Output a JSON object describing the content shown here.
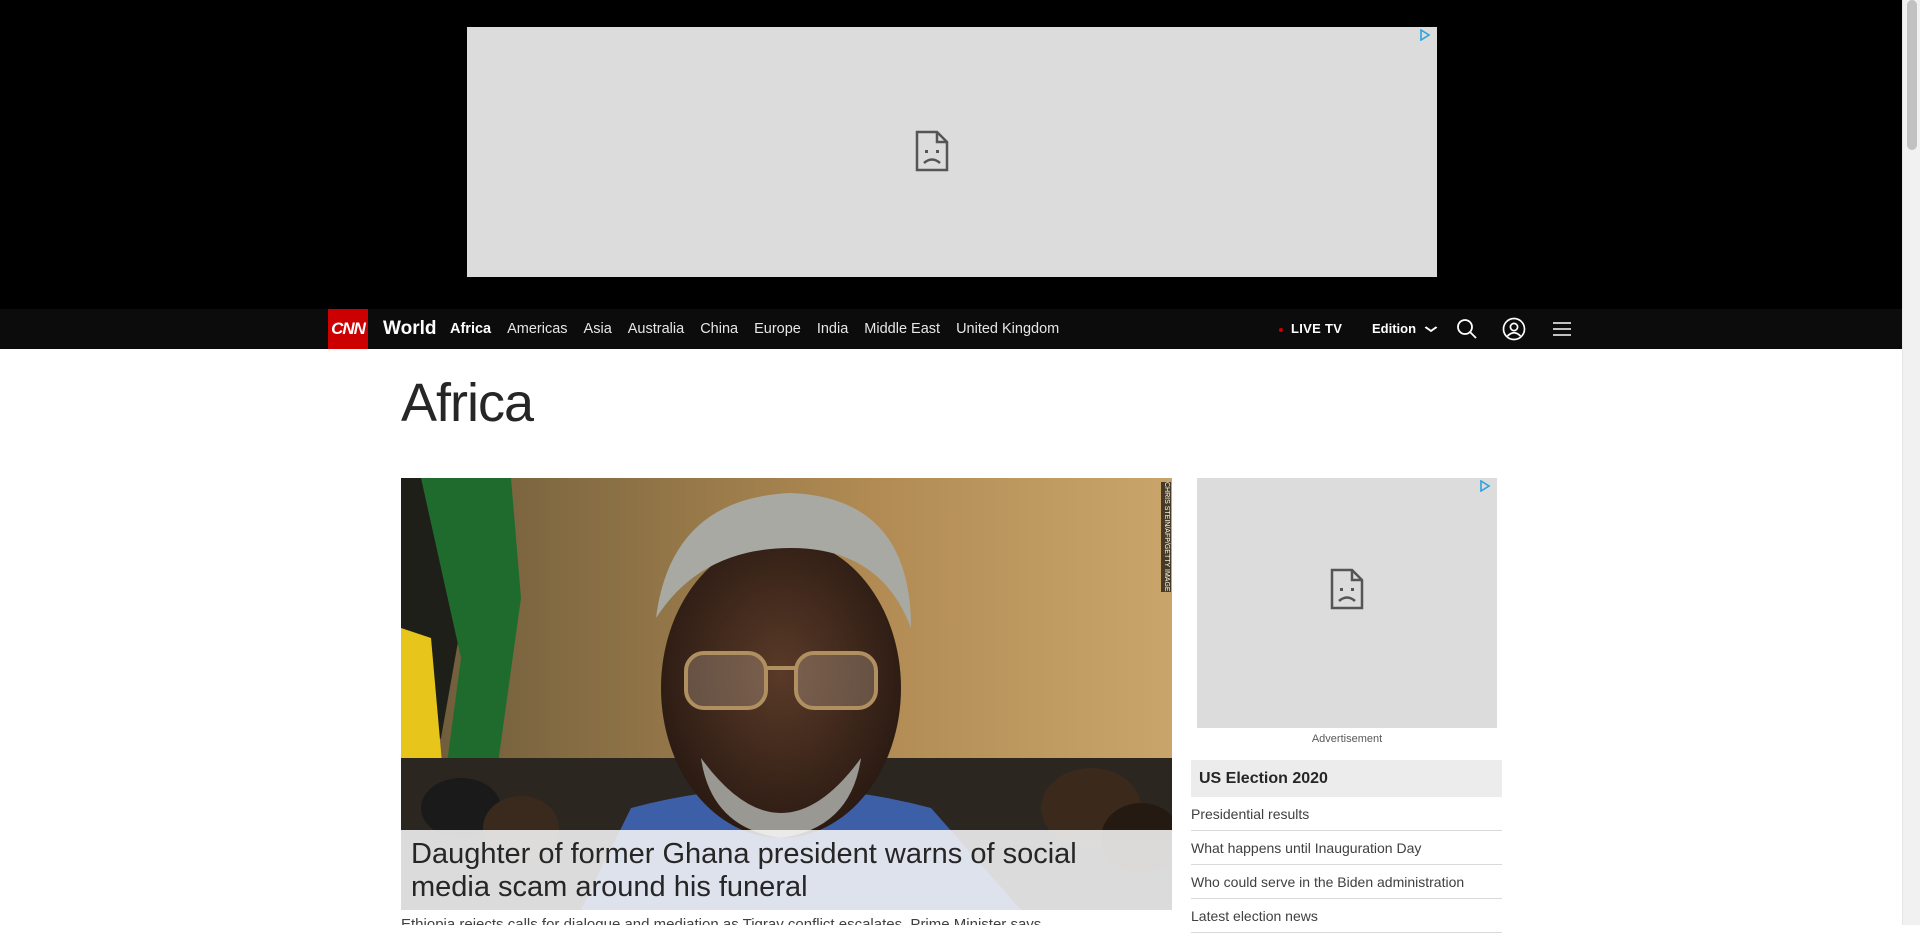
{
  "nav": {
    "logo": "CNN",
    "section": "World",
    "links": [
      "Africa",
      "Americas",
      "Asia",
      "Australia",
      "China",
      "Europe",
      "India",
      "Middle East",
      "United Kingdom"
    ],
    "active_link": "Africa",
    "live_tv": "LIVE TV",
    "edition": "Edition"
  },
  "page": {
    "title": "Africa"
  },
  "hero": {
    "photo_credit": "CHRIS STEIN/AFP/GETTY IMAGES",
    "headline": "Daughter of former Ghana president warns of social media scam around his funeral",
    "subtext": "Ethiopia rejects calls for dialogue and mediation as Tigray conflict escalates, Prime Minister says"
  },
  "side_ad": {
    "label": "Advertisement"
  },
  "election": {
    "heading": "US Election 2020",
    "items": [
      "Presidential results",
      "What happens until Inauguration Day",
      "Who could serve in the Biden administration",
      "Latest election news"
    ]
  },
  "colors": {
    "brand_red": "#cc0000",
    "nav_bg": "#0c0c0c",
    "ad_placeholder": "#dcdcdc"
  },
  "icons": {
    "search": "search-icon",
    "account": "account-icon",
    "menu": "hamburger-menu-icon",
    "ad_choices": "adchoices-icon",
    "broken_image": "broken-image-icon"
  }
}
